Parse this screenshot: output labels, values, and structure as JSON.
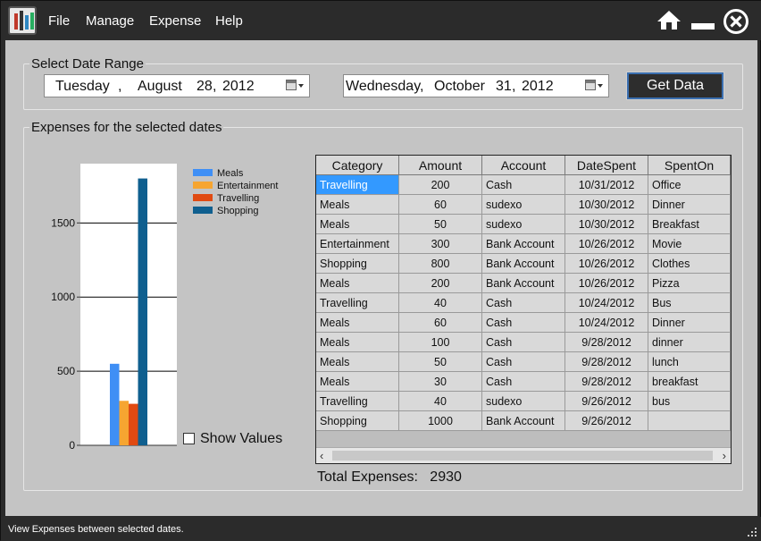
{
  "menu": {
    "items": [
      "File",
      "Manage",
      "Expense",
      "Help"
    ]
  },
  "window_controls": {
    "home_icon": "home-icon",
    "minimize_icon": "minimize-icon",
    "close_icon": "close-circle-icon"
  },
  "date_range": {
    "title": "Select Date Range",
    "from": {
      "weekday": "Tuesday",
      "month": "August",
      "day": "28",
      "year": "2012"
    },
    "to": {
      "weekday": "Wednesday",
      "month": "October",
      "day": "31",
      "year": "2012"
    },
    "get_data_label": "Get Data"
  },
  "expenses": {
    "title": "Expenses for the selected dates",
    "show_values_label": "Show Values",
    "show_values_checked": false,
    "total_label": "Total Expenses:",
    "total_value": "2930"
  },
  "chart_data": {
    "type": "bar",
    "categories": [
      "Meals",
      "Entertainment",
      "Travelling",
      "Shopping"
    ],
    "values": [
      550,
      300,
      280,
      1800
    ],
    "colors": [
      "#3f8ff5",
      "#f6a531",
      "#e04a12",
      "#0f5f8f"
    ],
    "ylim": [
      0,
      1900
    ],
    "yticks": [
      "0",
      "500",
      "1000",
      "1500"
    ],
    "ytick_values": [
      0,
      500,
      1000,
      1500
    ],
    "legend": [
      "Meals",
      "Entertainment",
      "Travelling",
      "Shopping"
    ],
    "grid": true,
    "legend_position": "top-right"
  },
  "table": {
    "columns": [
      "Category",
      "Amount",
      "Account",
      "DateSpent",
      "SpentOn"
    ],
    "rows": [
      [
        "Travelling",
        "200",
        "Cash",
        "10/31/2012",
        "Office"
      ],
      [
        "Meals",
        "60",
        "sudexo",
        "10/30/2012",
        "Dinner"
      ],
      [
        "Meals",
        "50",
        "sudexo",
        "10/30/2012",
        "Breakfast"
      ],
      [
        "Entertainment",
        "300",
        "Bank Account",
        "10/26/2012",
        "Movie"
      ],
      [
        "Shopping",
        "800",
        "Bank Account",
        "10/26/2012",
        "Clothes"
      ],
      [
        "Meals",
        "200",
        "Bank Account",
        "10/26/2012",
        "Pizza"
      ],
      [
        "Travelling",
        "40",
        "Cash",
        "10/24/2012",
        "Bus"
      ],
      [
        "Meals",
        "60",
        "Cash",
        "10/24/2012",
        "Dinner"
      ],
      [
        "Meals",
        "100",
        "Cash",
        "9/28/2012",
        "dinner"
      ],
      [
        "Meals",
        "50",
        "Cash",
        "9/28/2012",
        "lunch"
      ],
      [
        "Meals",
        "30",
        "Cash",
        "9/28/2012",
        "breakfast"
      ],
      [
        "Travelling",
        "40",
        "sudexo",
        "9/26/2012",
        "bus"
      ],
      [
        "Shopping",
        "1000",
        "Bank Account",
        "9/26/2012",
        ""
      ]
    ],
    "selected_row": 0
  },
  "status": {
    "text": "View Expenses between selected dates."
  }
}
